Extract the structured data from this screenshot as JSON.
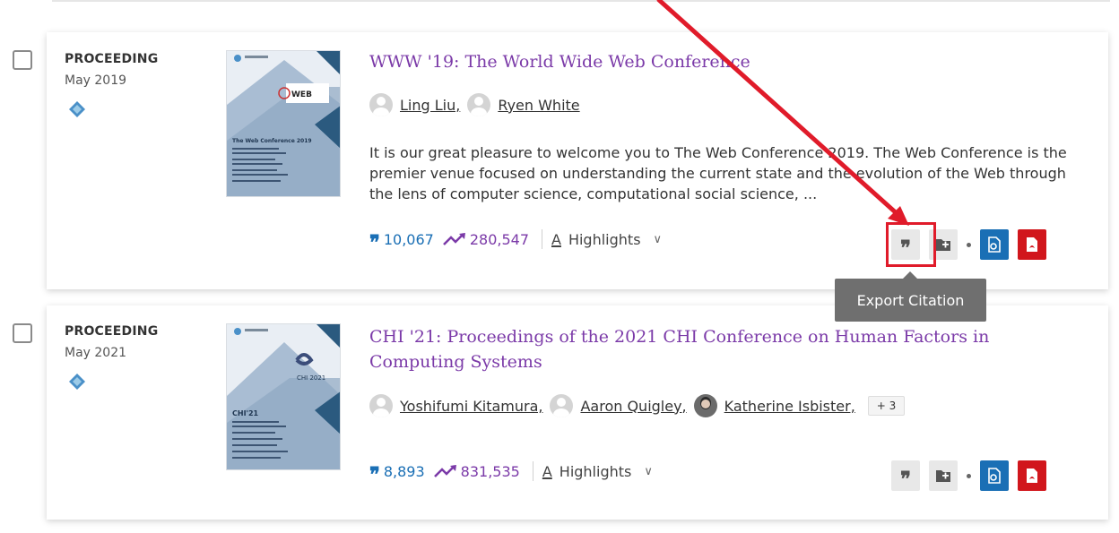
{
  "results": [
    {
      "type": "PROCEEDING",
      "date": "May 2019",
      "title": "WWW '19: The World Wide Web Conference",
      "authors": [
        {
          "name": "Ling Liu,",
          "avatar": "person-placeholder-icon"
        },
        {
          "name": "Ryen White",
          "avatar": "person-placeholder-icon"
        }
      ],
      "abstract": "It is our great pleasure to welcome you to The Web Conference 2019. The Web Conference is the premier venue focused on understanding the current state and the evolution of the Web through the lens of computer science, computational social science, ...",
      "citations": "10,067",
      "downloads": "280,547",
      "highlights_glyph": "A",
      "highlights_label": "Highlights",
      "cover": {
        "heading": "The Web Conference 2019",
        "logo_text": "WEB"
      }
    },
    {
      "type": "PROCEEDING",
      "date": "May 2021",
      "title": "CHI '21: Proceedings of the 2021 CHI Conference on Human Factors in Computing Systems",
      "authors": [
        {
          "name": "Yoshifumi Kitamura,",
          "avatar": "person-placeholder-icon"
        },
        {
          "name": "Aaron Quigley,",
          "avatar": "person-placeholder-icon"
        },
        {
          "name": "Katherine Isbister,",
          "avatar": "person-photo-icon"
        }
      ],
      "more_authors": "+ 3",
      "citations": "8,893",
      "downloads": "831,535",
      "highlights_glyph": "A",
      "highlights_label": "Highlights",
      "cover": {
        "heading": "CHI'21",
        "logo_text": "CHI 2021"
      }
    }
  ],
  "tooltip": {
    "text": "Export Citation"
  },
  "icons": {
    "acm_badge": "acm-diamond-icon",
    "citations": "quote-icon",
    "downloads": "trend-up-icon",
    "expand": "chevron-down-icon",
    "export_citation": "quote-icon",
    "add_to_binder": "folder-plus-icon",
    "get_access": "document-access-icon",
    "pdf": "pdf-icon"
  },
  "colors": {
    "title": "#7b3aa8",
    "citations": "#1a6fb5",
    "downloads": "#7b3aa8",
    "access_button": "#1a6fb5",
    "pdf_button": "#d1161c",
    "annotation": "#e01b2a",
    "tooltip_bg": "#6f6f6f"
  }
}
